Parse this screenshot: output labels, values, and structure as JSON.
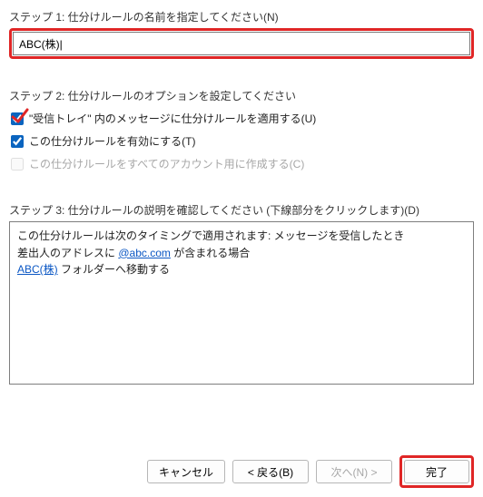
{
  "step1": {
    "label": "ステップ 1: 仕分けルールの名前を指定してください(N)",
    "value": "ABC(株)|"
  },
  "step2": {
    "label": "ステップ 2: 仕分けルールのオプションを設定してください",
    "opt1": {
      "checked": true,
      "label": "\"受信トレイ\" 内のメッセージに仕分けルールを適用する(U)"
    },
    "opt2": {
      "checked": true,
      "label": "この仕分けルールを有効にする(T)"
    },
    "opt3": {
      "checked": false,
      "label": "この仕分けルールをすべてのアカウント用に作成する(C)"
    }
  },
  "step3": {
    "label": "ステップ 3: 仕分けルールの説明を確認してください (下線部分をクリックします)(D)",
    "line1": "この仕分けルールは次のタイミングで適用されます: メッセージを受信したとき",
    "line2a": "差出人のアドレスに ",
    "line2link": "@abc.com",
    "line2b": " が含まれる場合",
    "line3link": "ABC(株)",
    "line3b": " フォルダーへ移動する"
  },
  "buttons": {
    "cancel": "キャンセル",
    "back": "< 戻る(B)",
    "next": "次へ(N) >",
    "finish": "完了"
  }
}
